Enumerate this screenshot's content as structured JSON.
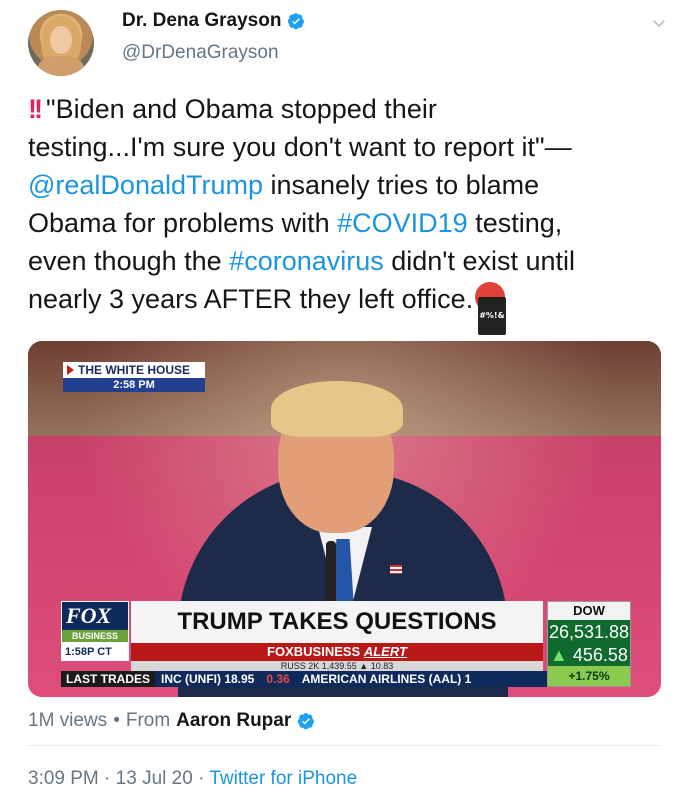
{
  "author": {
    "display_name": "Dr. Dena Grayson",
    "handle": "@DrDenaGrayson",
    "verified": true
  },
  "tweet": {
    "line1_text": "\"Biden and Obama stopped their",
    "line2_text": "testing...I'm sure you don't want to report it\"—",
    "mention": "@realDonaldTrump",
    "line3_rest": " insanely tries to blame",
    "line4_a": "Obama for problems with ",
    "hashtag_covid": "#COVID19",
    "line4_b": " testing,",
    "line5_a": "even though the ",
    "hashtag_corona": "#coronavirus",
    "line5_b": " didn't exist until",
    "line6": "nearly 3 years AFTER they left office.",
    "emoji_badge": "#%!&"
  },
  "video": {
    "location": "THE WHITE HOUSE",
    "location_time": "2:58 PM",
    "network": "FOX",
    "network_sub": "BUSINESS",
    "clock": "1:58P CT",
    "headline": "TRUMP TAKES QUESTIONS",
    "alert_brand": "FOXBUSINESS",
    "alert_word": "ALERT",
    "ticker_faint": "RUSS 2K   1,439.55  ▲ 10.83",
    "ticker_label": "LAST TRADES",
    "ticker_items": [
      "INC (UNFI) 18.95",
      "0.36",
      "AMERICAN AIRLINES (AAL) 1"
    ],
    "dow_label": "DOW",
    "dow_value": "26,531.88",
    "dow_change": "456.58",
    "dow_pct": "+1.75%"
  },
  "meta": {
    "views": "1M views",
    "separator": "•",
    "from_label": "From",
    "from_author": "Aaron Rupar",
    "time": "3:09 PM",
    "date": "13 Jul 20",
    "dot": "·",
    "source": "Twitter for iPhone"
  },
  "colors": {
    "link": "#1b95e0",
    "secondary_text": "#657786",
    "verified": "#1da1f2"
  }
}
